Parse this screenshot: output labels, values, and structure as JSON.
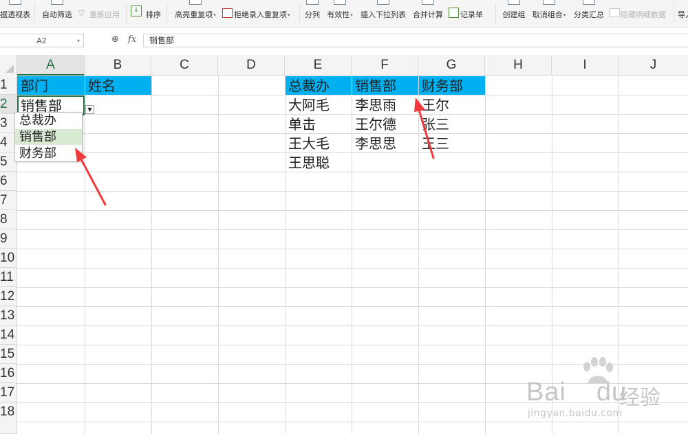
{
  "ribbon": {
    "items": [
      {
        "label": "据透视表",
        "dropdown": false,
        "disabled": false
      },
      {
        "label": "自动筛选",
        "dropdown": false,
        "disabled": false
      },
      {
        "label": "重新应用",
        "dropdown": false,
        "disabled": true
      },
      {
        "label": "排序",
        "dropdown": false,
        "disabled": false
      },
      {
        "label": "高亮重复项",
        "dropdown": true,
        "disabled": false
      },
      {
        "label": "拒绝录入重复项",
        "dropdown": true,
        "disabled": false
      },
      {
        "label": "分列",
        "dropdown": false,
        "disabled": false
      },
      {
        "label": "有效性",
        "dropdown": true,
        "disabled": false
      },
      {
        "label": "插入下拉列表",
        "dropdown": false,
        "disabled": false
      },
      {
        "label": "合并计算",
        "dropdown": false,
        "disabled": false
      },
      {
        "label": "记录单",
        "dropdown": false,
        "disabled": false
      },
      {
        "label": "创建组",
        "dropdown": false,
        "disabled": false
      },
      {
        "label": "取消组合",
        "dropdown": true,
        "disabled": false
      },
      {
        "label": "分类汇总",
        "dropdown": false,
        "disabled": false
      },
      {
        "label": "隐藏明细数据",
        "dropdown": false,
        "disabled": true
      },
      {
        "label": "导入",
        "dropdown": false,
        "disabled": false
      }
    ]
  },
  "formula_bar": {
    "name_box": "A2",
    "fx_label": "fx",
    "value": "销售部"
  },
  "columns": [
    "A",
    "B",
    "C",
    "D",
    "E",
    "F",
    "G",
    "H",
    "I",
    "J"
  ],
  "selected_column": "A",
  "rows": [
    "1",
    "2",
    "3",
    "4",
    "5",
    "6",
    "7",
    "8",
    "9",
    "10",
    "11",
    "12",
    "13",
    "14",
    "15",
    "16",
    "17",
    "18"
  ],
  "selected_row": "2",
  "cells": {
    "A1": "部门",
    "B1": "姓名",
    "A2": "销售部",
    "E1": "总裁办",
    "F1": "销售部",
    "G1": "财务部",
    "E2": "大阿毛",
    "E3": "单击",
    "E4": "王大毛",
    "E5": "王思聪",
    "F2": "李思雨",
    "F3": "王尔德",
    "F4": "李思思",
    "G2": "王尔",
    "G3": "张三",
    "G4": "王三"
  },
  "dropdown": {
    "options": [
      "总裁办",
      "销售部",
      "财务部"
    ],
    "highlighted_index": 1
  },
  "colors": {
    "header_fill": "#00b0f0",
    "selection": "#217346",
    "arrow": "#f0393c",
    "highlight": "#d9ead3"
  },
  "watermark": {
    "brand": "Bai",
    "brand2": "du",
    "cn": "经验",
    "url": "jingyan.baidu.com"
  }
}
